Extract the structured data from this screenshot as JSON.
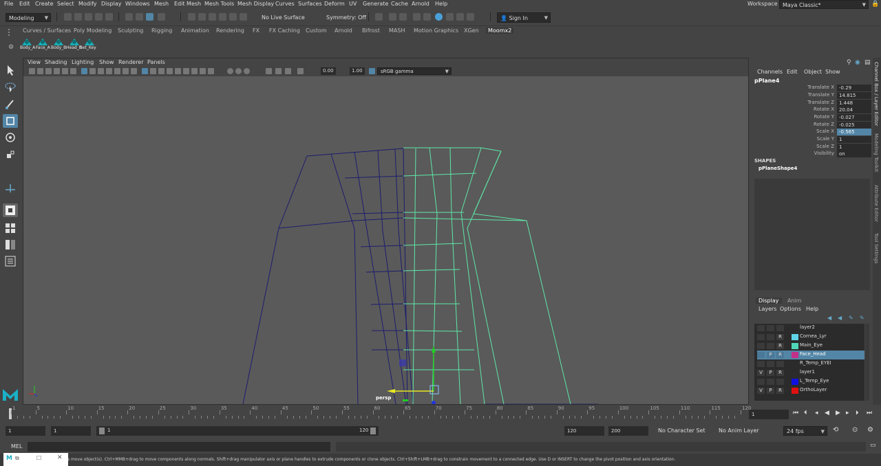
{
  "menubar": {
    "items": [
      "File",
      "Edit",
      "Create",
      "Select",
      "Modify",
      "Display",
      "Windows",
      "Mesh",
      "Edit Mesh",
      "Mesh Tools",
      "Mesh Display",
      "Curves",
      "Surfaces",
      "Deform",
      "UV",
      "Generate",
      "Cache",
      "Arnold",
      "Help"
    ],
    "workspace_label": "Workspace :",
    "workspace_value": "Maya Classic*"
  },
  "statusline": {
    "mode": "Modeling",
    "live_surface": "No Live Surface",
    "symmetry": "Symmetry: Off",
    "sign_in": "Sign In"
  },
  "shelf": {
    "tabs": [
      "Curves / Surfaces",
      "Poly Modeling",
      "Sculpting",
      "Rigging",
      "Animation",
      "Rendering",
      "FX",
      "FX Caching",
      "Custom",
      "Arnold",
      "Bifrost",
      "MASH",
      "Motion Graphics",
      "XGen",
      "Moomx2"
    ],
    "active_tab": "Moomx2",
    "buttons": [
      "Body_A",
      "Face_A",
      "Body_B",
      "Head_B",
      "Set_Key"
    ]
  },
  "viewport": {
    "menus": [
      "View",
      "Shading",
      "Lighting",
      "Show",
      "Renderer",
      "Panels"
    ],
    "exposure": "0.00",
    "gamma": "1.00",
    "colorspace": "sRGB gamma",
    "camera_label": "persp"
  },
  "channelbox": {
    "menus": [
      "Channels",
      "Edit",
      "Object",
      "Show"
    ],
    "object_name": "pPlane4",
    "attributes": [
      {
        "label": "Translate X",
        "value": "-0.29"
      },
      {
        "label": "Translate Y",
        "value": "14.815"
      },
      {
        "label": "Translate Z",
        "value": "1.448"
      },
      {
        "label": "Rotate X",
        "value": "20.04"
      },
      {
        "label": "Rotate Y",
        "value": "-0.027"
      },
      {
        "label": "Rotate Z",
        "value": "-0.025"
      },
      {
        "label": "Scale X",
        "value": "-0.565"
      },
      {
        "label": "Scale Y",
        "value": "1"
      },
      {
        "label": "Scale Z",
        "value": "1"
      },
      {
        "label": "Visibility",
        "value": "on"
      }
    ],
    "shapes_header": "SHAPES",
    "shape_name": "pPlaneShape4"
  },
  "sidetabs": [
    "Channel Box / Layer Editor",
    "Modeling Toolkit",
    "Attribute Editor",
    "Tool Settings"
  ],
  "layer_editor": {
    "tabs": [
      "Display",
      "Anim"
    ],
    "menus": [
      "Layers",
      "Options",
      "Help"
    ],
    "layers": [
      {
        "v": "",
        "p": "",
        "r": "",
        "name": "layer2",
        "color": "",
        "selected": false
      },
      {
        "v": "",
        "p": "",
        "r": "R",
        "name": "Cornea_Lyr",
        "color": "#5fd3e8",
        "selected": false
      },
      {
        "v": "",
        "p": "",
        "r": "R",
        "name": "Main_Eye",
        "color": "#4fd6b8",
        "selected": false
      },
      {
        "v": "",
        "p": "P",
        "r": "R",
        "name": "Face_Head",
        "color": "#c2308a",
        "selected": true
      },
      {
        "v": "",
        "p": "",
        "r": "",
        "name": "R_Temp_EYEI",
        "color": "",
        "selected": false
      },
      {
        "v": "V",
        "p": "P",
        "r": "R",
        "name": "layer1",
        "color": "",
        "selected": false
      },
      {
        "v": "",
        "p": "",
        "r": "",
        "name": "L_Temp_Eye",
        "color": "#1010e0",
        "selected": false
      },
      {
        "v": "V",
        "p": "P",
        "r": "R",
        "name": "OrthoLayer",
        "color": "#e01010",
        "selected": false
      }
    ]
  },
  "timeslider": {
    "ticks": [
      "1",
      "5",
      "10",
      "15",
      "20",
      "25",
      "30",
      "35",
      "40",
      "45",
      "50",
      "55",
      "60",
      "65",
      "70",
      "75",
      "80",
      "85",
      "90",
      "95",
      "100",
      "105",
      "110",
      "115",
      "120"
    ],
    "current_frame": "1"
  },
  "rangebar": {
    "start": "1",
    "playback_start": "1",
    "range_start": "1",
    "range_end": "120",
    "playback_end": "120",
    "end": "200",
    "character_set": "No Character Set",
    "anim_layer": "No Anim Layer",
    "fps": "24 fps"
  },
  "cmdline": {
    "label": "MEL"
  },
  "helpline": {
    "text": "s move object(s). Ctrl+MMB+drag to move components along normals. Shift+drag manipulator axis or plane handles to extrude components or clone objects. Ctrl+Shift+LMB+drag to constrain movement to a connected edge. Use D or INSERT to change the pivot position and axis orientation."
  },
  "colors": {
    "accent": "#5285a6",
    "wire_dark": "#1c1c6e",
    "wire_light": "#5ee8a8",
    "bg": "#444444",
    "viewport": "#5a5a5a"
  }
}
